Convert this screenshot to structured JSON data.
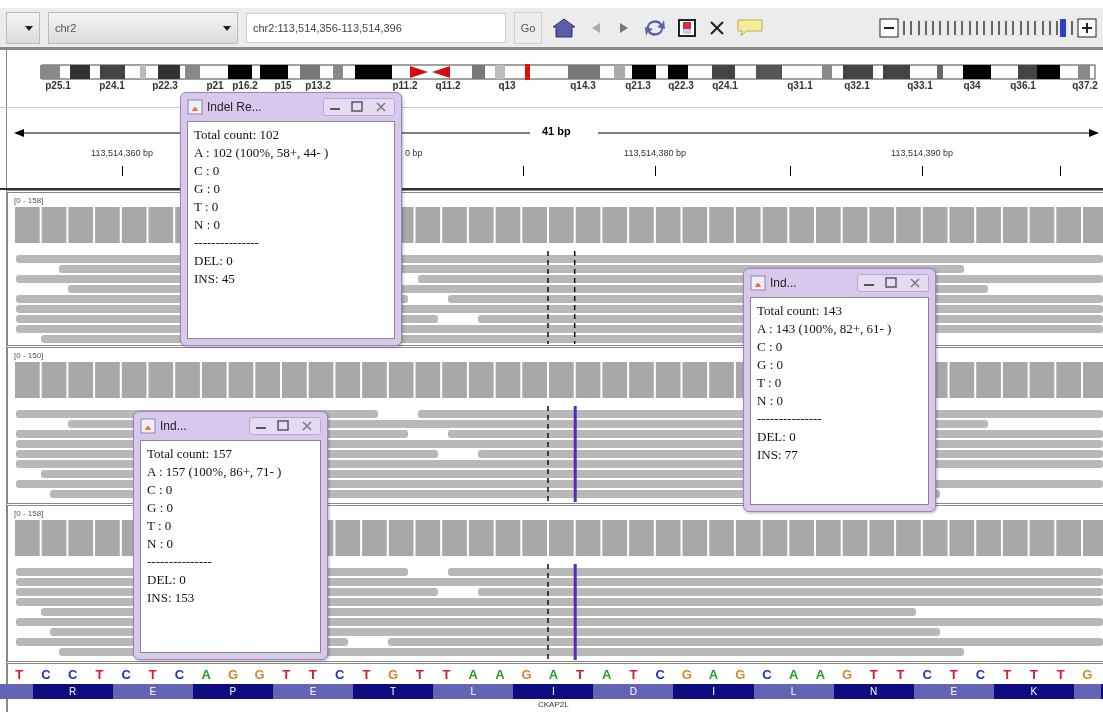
{
  "toolbar": {
    "chromosome": {
      "value": "chr2"
    },
    "locus": {
      "value": "chr2:113,514,356-113,514,396"
    },
    "go": "Go",
    "zoom": {
      "level": 0.96
    }
  },
  "ideogram": {
    "bands": [
      "p25.1",
      "p24.1",
      "p22.3",
      "p21",
      "p16.2",
      "p15",
      "p13.2",
      "p11.2",
      "q11.2",
      "q13",
      "q14.3",
      "q21.3",
      "q22.3",
      "q24.1",
      "q31.1",
      "q32.1",
      "q33.1",
      "q34",
      "q36.1",
      "q37.2"
    ]
  },
  "ruler": {
    "span": "41 bp",
    "labels": [
      "113,514,360 bp",
      "0 bp",
      "113,514,380 bp",
      "113,514,390 bp"
    ]
  },
  "tracks": [
    {
      "range": "[0 - 158]"
    },
    {
      "range": "[0 - 150]"
    },
    {
      "range": "[0 - 158]"
    }
  ],
  "popups": [
    {
      "title": "Indel Re...",
      "lines": [
        "Total count: 102",
        "A : 102 (100%, 58+, 44- )",
        "C : 0",
        "G : 0",
        "T : 0",
        "N : 0",
        "---------------",
        "DEL: 0",
        "INS: 45"
      ]
    },
    {
      "title": "Ind...",
      "lines": [
        "Total count: 143",
        "A : 143 (100%, 82+, 61- )",
        "C : 0",
        "G : 0",
        "T : 0",
        "N : 0",
        "---------------",
        "DEL: 0",
        "INS: 77"
      ]
    },
    {
      "title": "Ind...",
      "lines": [
        "Total count: 157",
        "A : 157 (100%, 86+, 71- )",
        "C : 0",
        "G : 0",
        "T : 0",
        "N : 0",
        "---------------",
        "DEL: 0",
        "INS: 153"
      ]
    }
  ],
  "sequence": {
    "bases": [
      {
        "base": "T",
        "color": "#d42020"
      },
      {
        "base": "C",
        "color": "#2030c0"
      },
      {
        "base": "C",
        "color": "#2030c0"
      },
      {
        "base": "T",
        "color": "#d42020"
      },
      {
        "base": "C",
        "color": "#2030c0"
      },
      {
        "base": "T",
        "color": "#d42020"
      },
      {
        "base": "C",
        "color": "#2030c0"
      },
      {
        "base": "A",
        "color": "#20a020"
      },
      {
        "base": "G",
        "color": "#d18a2a"
      },
      {
        "base": "G",
        "color": "#d18a2a"
      },
      {
        "base": "T",
        "color": "#d42020"
      },
      {
        "base": "T",
        "color": "#d42020"
      },
      {
        "base": "C",
        "color": "#2030c0"
      },
      {
        "base": "T",
        "color": "#d42020"
      },
      {
        "base": "G",
        "color": "#d18a2a"
      },
      {
        "base": "T",
        "color": "#d42020"
      },
      {
        "base": "T",
        "color": "#d42020"
      },
      {
        "base": "A",
        "color": "#20a020"
      },
      {
        "base": "A",
        "color": "#20a020"
      },
      {
        "base": "G",
        "color": "#d18a2a"
      },
      {
        "base": "A",
        "color": "#20a020"
      },
      {
        "base": "T",
        "color": "#d42020"
      },
      {
        "base": "A",
        "color": "#20a020"
      },
      {
        "base": "T",
        "color": "#d42020"
      },
      {
        "base": "C",
        "color": "#2030c0"
      },
      {
        "base": "G",
        "color": "#d18a2a"
      },
      {
        "base": "A",
        "color": "#20a020"
      },
      {
        "base": "G",
        "color": "#d18a2a"
      },
      {
        "base": "C",
        "color": "#2030c0"
      },
      {
        "base": "A",
        "color": "#20a020"
      },
      {
        "base": "A",
        "color": "#20a020"
      },
      {
        "base": "G",
        "color": "#d18a2a"
      },
      {
        "base": "T",
        "color": "#d42020"
      },
      {
        "base": "T",
        "color": "#d42020"
      },
      {
        "base": "C",
        "color": "#2030c0"
      },
      {
        "base": "T",
        "color": "#d42020"
      },
      {
        "base": "C",
        "color": "#2030c0"
      },
      {
        "base": "T",
        "color": "#d42020"
      },
      {
        "base": "T",
        "color": "#d42020"
      },
      {
        "base": "T",
        "color": "#d42020"
      },
      {
        "base": "G",
        "color": "#d18a2a"
      }
    ],
    "amino_acids": [
      "R",
      "E",
      "P",
      "E",
      "T",
      "L",
      "I",
      "D",
      "I",
      "L",
      "N",
      "E",
      "K"
    ],
    "gene": "CKAP2L"
  }
}
